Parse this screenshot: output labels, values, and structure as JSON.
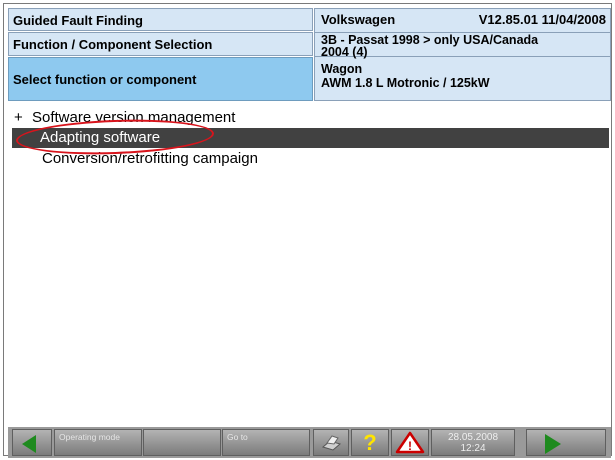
{
  "header": {
    "left": {
      "line1": "Guided Fault Finding",
      "line2": "Function / Component Selection",
      "line3": "Select function or component"
    },
    "right": {
      "brand": "Volkswagen",
      "version": "V12.85.01 11/04/2008",
      "model_line1": "3B - Passat 1998 > only USA/Canada",
      "model_line2": "2004 (4)",
      "body_type": "Wagon",
      "engine": "AWM 1.8 L Motronic / 125kW"
    }
  },
  "list": {
    "items": [
      {
        "prefix": "+",
        "label": "Software version management"
      },
      {
        "label": "Adapting software",
        "selected": true
      },
      {
        "label": "Conversion/retrofitting campaign"
      }
    ]
  },
  "toolbar": {
    "operating_mode": "Operating mode",
    "go_to": "Go to",
    "help": "?",
    "warning": "!",
    "date": "28.05.2008",
    "time": "12:24"
  },
  "colors": {
    "header_light": "#d6e6f5",
    "header_active": "#8ec9ef",
    "selection": "#414141",
    "annotation_circle": "#d8141c",
    "nav_arrow": "#1e8a1e"
  },
  "icons": [
    "back-arrow-icon",
    "printer-icon",
    "help-icon",
    "warning-icon",
    "forward-arrow-icon"
  ]
}
